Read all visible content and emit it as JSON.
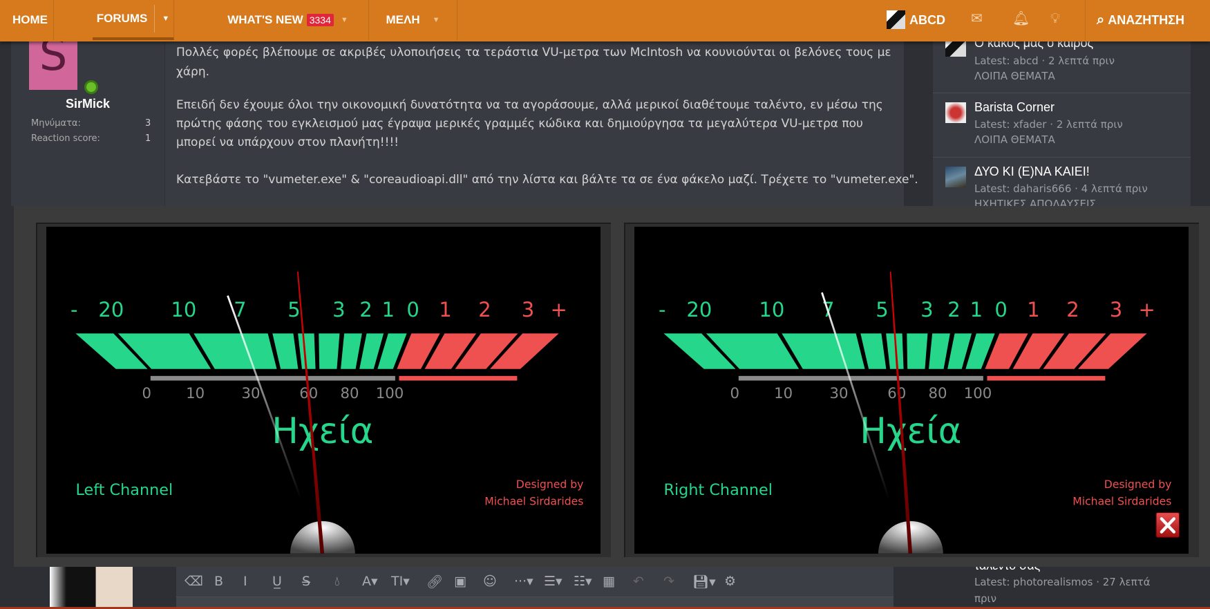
{
  "nav": {
    "items": [
      {
        "label": "HOME"
      },
      {
        "label": "FORUMS"
      },
      {
        "label": "WHAT'S NEW",
        "badge": "3334"
      },
      {
        "label": "ΜΕΛΗ"
      }
    ],
    "user": "ABCD",
    "search": "ΑΝΑΖΗΤΗΣΗ",
    "accent": "#d67a1d"
  },
  "post": {
    "author": "SirMick",
    "avatar_letter": "S",
    "stats": [
      {
        "label": "Μηνύματα:",
        "value": "3"
      },
      {
        "label": "Reaction score:",
        "value": "1"
      }
    ],
    "lines": [
      "Πολλές φορές βλέπουμε σε ακριβές υλοποιήσεις τα τεράστια VU-μετρα των McIntosh να κουνιούνται οι βελόνες τους με",
      "χάρη.",
      "Επειδή δεν έχουμε όλοι την οικονομική δυνατότητα να τα αγοράσουμε, αλλά μερικοί διαθέτουμε ταλέντο, εν μέσω της",
      "πρώτης φάσης του εγκλεισμού μας έγραψα μερικές γραμμές κώδικα και δημιούργησα τα μεγαλύτερα VU-μετρα που",
      "μπορεί να υπάρχουν στον πλανήτη!!!!",
      "Κατεβάστε το \"vumeter.exe\" & \"coreaudioapi.dll\" από την λίστα και βάλτε τα σε ένα φάκελο μαζί. Τρέχετε το \"vumeter.exe\"."
    ]
  },
  "sidebar": {
    "items": [
      {
        "title": "Ο κακός μας ο καιρός",
        "latest": "Latest: abcd · 2 λεπτά πριν",
        "category": "ΛΟΙΠΑ ΘΕΜΑΤΑ"
      },
      {
        "title": "Barista Corner",
        "latest": "Latest: xfader · 2 λεπτά πριν",
        "category": "ΛΟΙΠΑ ΘΕΜΑΤΑ"
      },
      {
        "title": "ΔΥΟ ΚΙ (Ε)ΝΑ ΚΑΙΕΙ!",
        "latest": "Latest: daharis666 · 4 λεπτά πριν",
        "category": "ΗΧΗΤΙΚΕΣ ΑΠΟΛΑΥΣΕΙΣ"
      },
      {
        "title": "ταλέντο σας",
        "latest": "Latest: photorealismos · 27 λεπτά",
        "latest2": "πριν"
      }
    ]
  },
  "vumeter": {
    "db_labels": [
      "-",
      "20",
      "10",
      "7",
      "5",
      "3",
      "2",
      "1",
      "0",
      "1",
      "2",
      "3",
      "+"
    ],
    "pct_labels": [
      "0",
      "10",
      "30",
      "60",
      "80",
      "100"
    ],
    "title": "Ηχεία",
    "credit1": "Designed by",
    "credit2": "Michael Sirdarides",
    "green": "#26d68a",
    "red": "#ef5050",
    "channels": [
      {
        "label": "Left Channel"
      },
      {
        "label": "Right Channel"
      }
    ]
  },
  "toolbar": {
    "icons": [
      "eraser-icon",
      "bold-icon",
      "italic-icon",
      "underline-icon",
      "strikethrough-icon",
      "color-drop-icon",
      "font-family-icon",
      "font-size-icon",
      "link-icon",
      "image-icon",
      "smiley-icon",
      "more-icon",
      "align-icon",
      "list-icon",
      "table-icon",
      "undo-icon",
      "redo-icon",
      "save-draft-icon",
      "settings-gear-icon"
    ]
  }
}
